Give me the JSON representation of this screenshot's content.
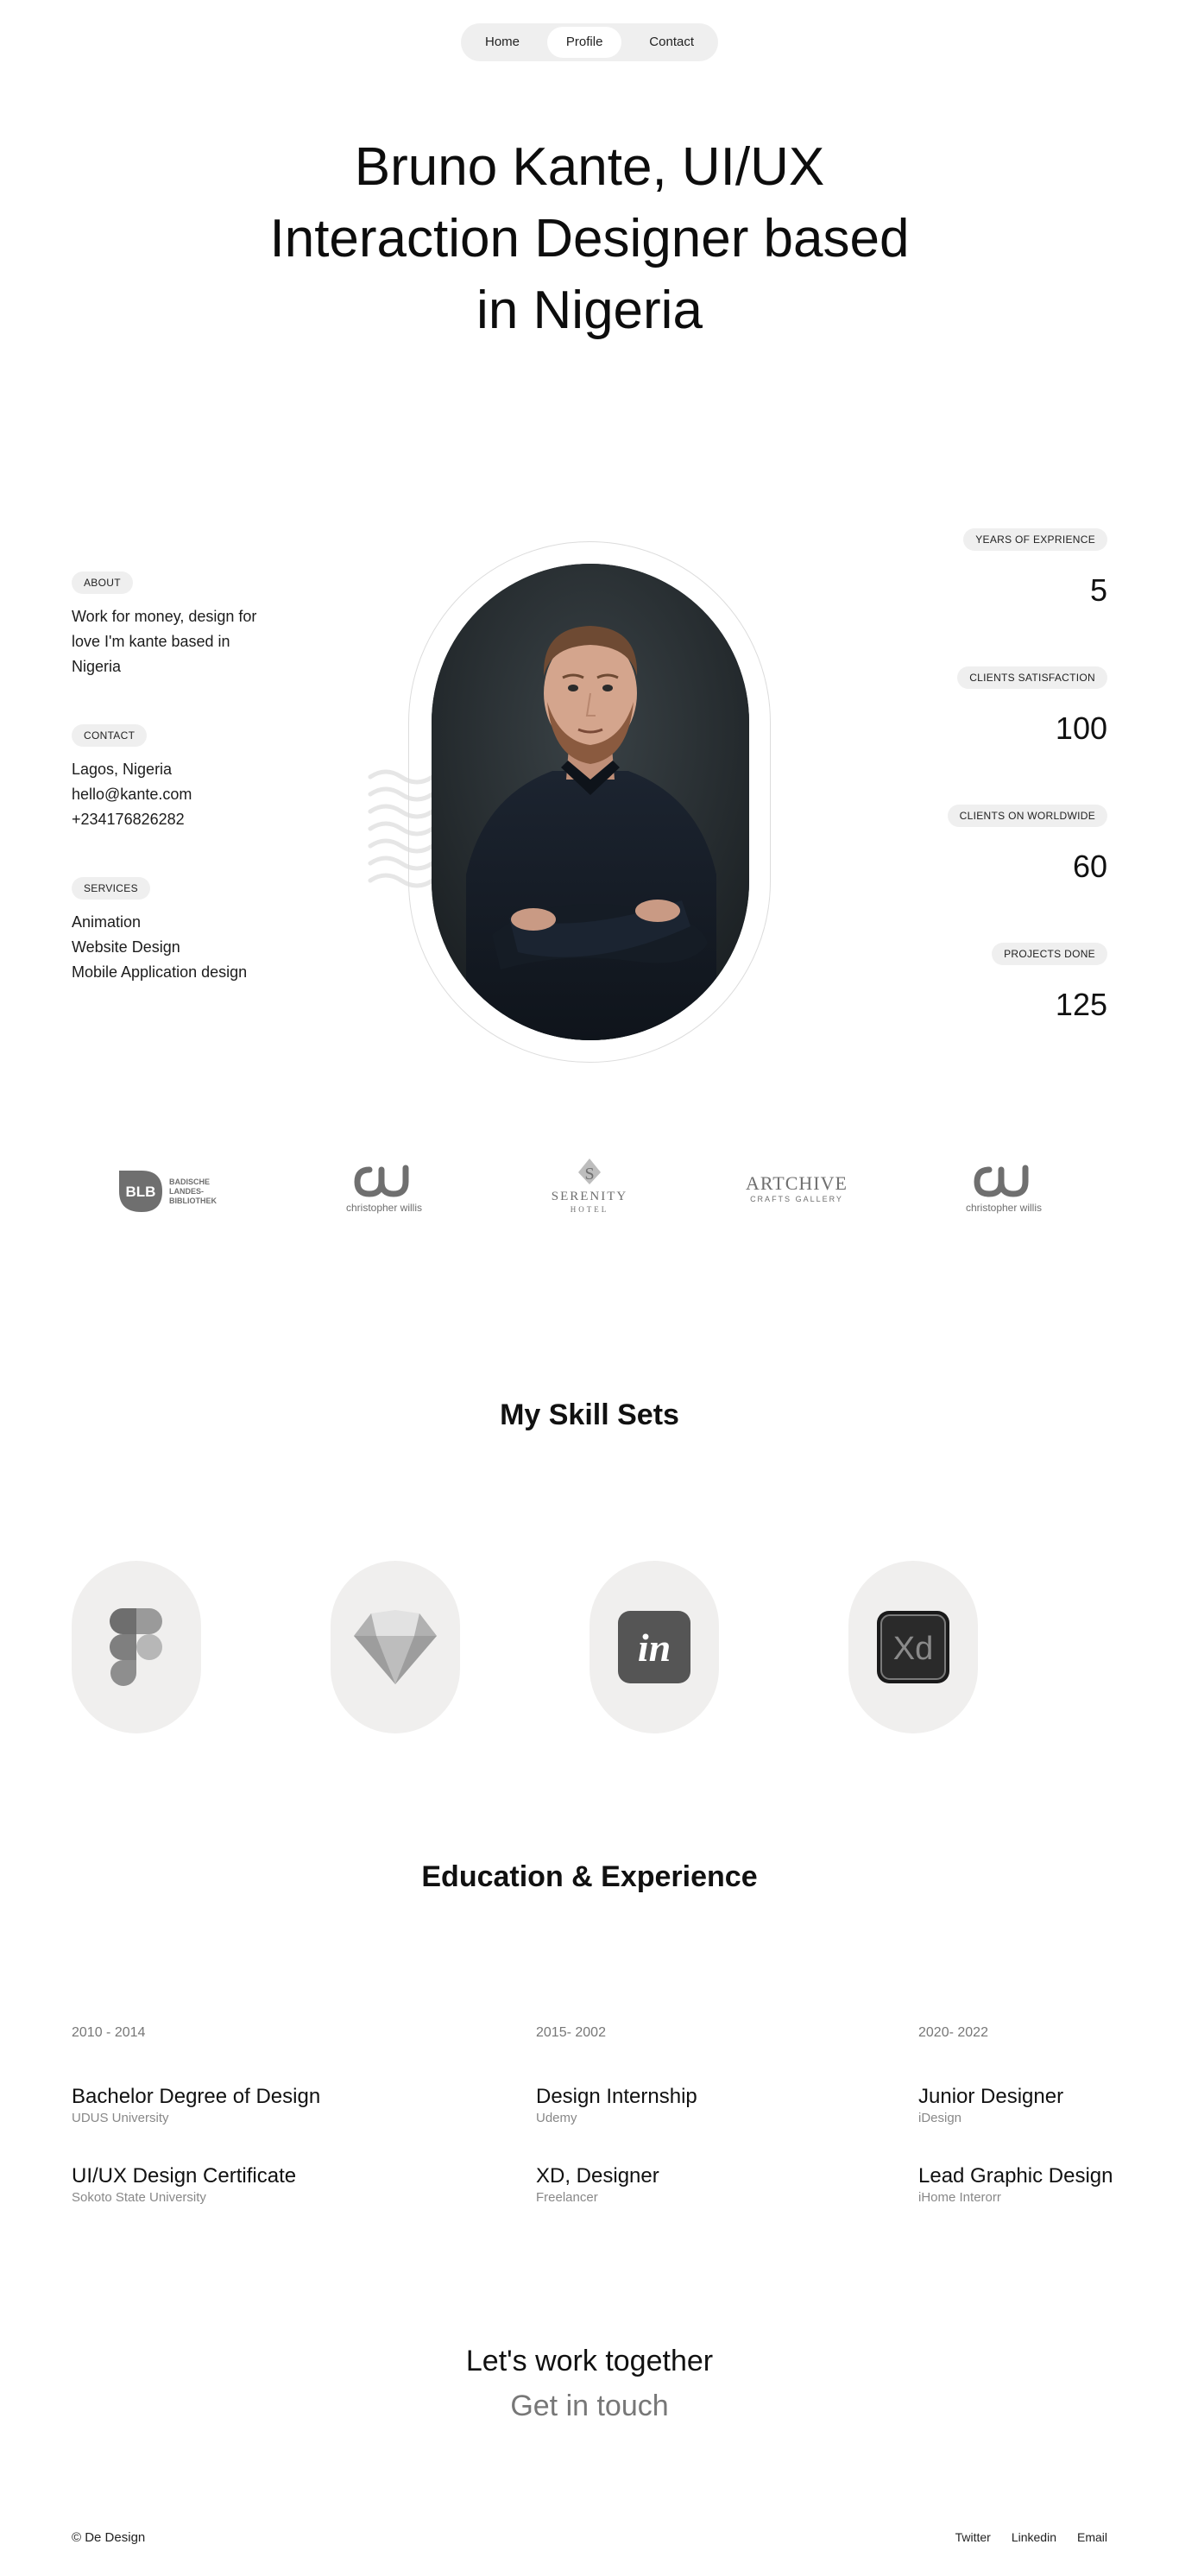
{
  "nav": {
    "items": [
      {
        "label": "Home"
      },
      {
        "label": "Profile",
        "active": true
      },
      {
        "label": "Contact"
      }
    ]
  },
  "hero": {
    "lines": [
      "Bruno Kante, UI/UX",
      "Interaction Designer based",
      "in Nigeria"
    ]
  },
  "about": {
    "label": "ABOUT",
    "lines": [
      "Work for money, design for",
      "love I'm kante based in",
      "Nigeria"
    ]
  },
  "contact": {
    "label": "CONTACT",
    "lines": [
      "Lagos, Nigeria",
      "hello@kante.com",
      "+234176826282"
    ]
  },
  "services": {
    "label": "SERVICES",
    "lines": [
      "Animation",
      "Website Design",
      "Mobile Application design"
    ]
  },
  "stats": [
    {
      "label": "YEARS OF EXPRIENCE",
      "value": "5"
    },
    {
      "label": "CLIENTS SATISFACTION",
      "value": "100"
    },
    {
      "label": "CLIENTS ON WORLDWIDE",
      "value": "60"
    },
    {
      "label": "PROJECTS DONE",
      "value": "125"
    }
  ],
  "logos": [
    {
      "name": "blb-logo",
      "mark": "BLB",
      "text": [
        "BADISCHE",
        "LANDES-",
        "BIBLIOTHEK"
      ]
    },
    {
      "name": "christopher-willis-logo",
      "text": "christopher willis"
    },
    {
      "name": "serenity-hotel-logo",
      "mark": "S",
      "text": [
        "SERENITY",
        "HOTEL"
      ]
    },
    {
      "name": "artchive-logo",
      "text": [
        "ARTCHIVE",
        "CRAFTS GALLERY"
      ]
    },
    {
      "name": "christopher-willis-logo-2",
      "text": "christopher willis"
    }
  ],
  "skills": {
    "title": "My Skill Sets",
    "icons": [
      "figma-icon",
      "sketch-icon",
      "invision-icon",
      "adobe-xd-icon"
    ]
  },
  "education": {
    "title": "Education & Experience",
    "columns": [
      {
        "years": "2010 - 2014",
        "items": [
          {
            "title": "Bachelor Degree of Design",
            "sub": "UDUS University"
          },
          {
            "title": "UI/UX Design Certificate",
            "sub": "Sokoto State University"
          }
        ]
      },
      {
        "years": "2015- 2002",
        "items": [
          {
            "title": "Design Internship",
            "sub": "Udemy"
          },
          {
            "title": "XD, Designer",
            "sub": "Freelancer"
          }
        ]
      },
      {
        "years": "2020- 2022",
        "items": [
          {
            "title": "Junior Designer",
            "sub": "iDesign"
          },
          {
            "title": "Lead Graphic Design",
            "sub": "iHome Interorr"
          }
        ]
      }
    ]
  },
  "cta": {
    "line1": "Let's work together",
    "line2": "Get in touch"
  },
  "footer": {
    "copyright": "© De Design",
    "links": [
      "Twitter",
      "Linkedin",
      "Email"
    ]
  }
}
